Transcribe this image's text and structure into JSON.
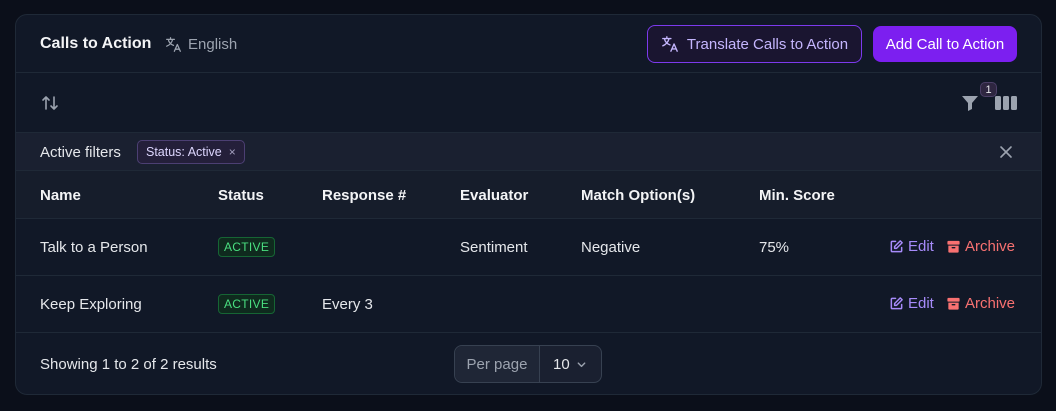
{
  "header": {
    "title": "Calls to Action",
    "language": "English",
    "translate_button": "Translate Calls to Action",
    "add_button": "Add Call to Action"
  },
  "toolbar": {
    "filter_count": "1",
    "icons": [
      "sort-icon",
      "filter-icon",
      "columns-icon"
    ]
  },
  "filters": {
    "label": "Active filters",
    "chips": [
      {
        "label": "Status: Active",
        "remove": "×"
      }
    ]
  },
  "table": {
    "columns": [
      "Name",
      "Status",
      "Response #",
      "Evaluator",
      "Match Option(s)",
      "Min. Score"
    ],
    "rows": [
      {
        "name": "Talk to a Person",
        "status": "ACTIVE",
        "response": "",
        "evaluator": "Sentiment",
        "match": "Negative",
        "min_score": "75%",
        "edit": "Edit",
        "archive": "Archive"
      },
      {
        "name": "Keep Exploring",
        "status": "ACTIVE",
        "response": "Every 3",
        "evaluator": "",
        "match": "",
        "min_score": "",
        "edit": "Edit",
        "archive": "Archive"
      }
    ]
  },
  "footer": {
    "showing": "Showing 1 to 2 of 2 results",
    "per_page_label": "Per page",
    "per_page_value": "10"
  },
  "colors": {
    "accent": "#7c1ff0",
    "active_badge": "#4ade80",
    "edit": "#a78bfa",
    "archive": "#f87171"
  }
}
